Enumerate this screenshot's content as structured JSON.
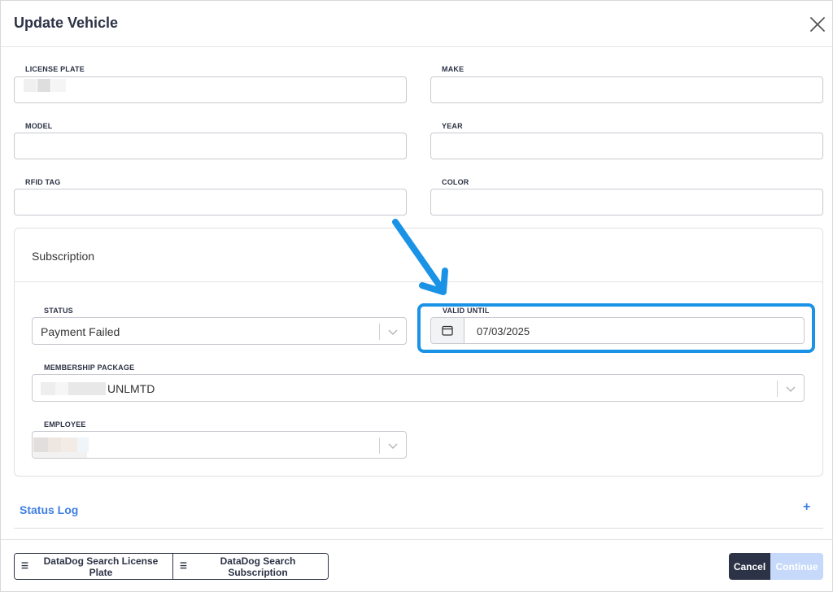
{
  "modal": {
    "title": "Update Vehicle",
    "close_icon": "close-icon"
  },
  "fields": {
    "license_plate": {
      "label": "LICENSE PLATE",
      "value": ""
    },
    "make": {
      "label": "MAKE",
      "value": ""
    },
    "model": {
      "label": "MODEL",
      "value": ""
    },
    "year": {
      "label": "YEAR",
      "value": ""
    },
    "rfid_tag": {
      "label": "RFID TAG",
      "value": ""
    },
    "color": {
      "label": "COLOR",
      "value": ""
    }
  },
  "subscription": {
    "title": "Subscription",
    "status": {
      "label": "STATUS",
      "value": "Payment Failed"
    },
    "valid_until": {
      "label": "VALID UNTIL",
      "value": "07/03/2025",
      "icon": "calendar-icon"
    },
    "membership_package": {
      "label": "MEMBERSHIP PACKAGE",
      "value": "UNLMTD"
    },
    "employee": {
      "label": "EMPLOYEE",
      "value": ""
    }
  },
  "status_log": {
    "title": "Status Log",
    "expand": "+"
  },
  "footer": {
    "datadog_license_plate": "DataDog Search License Plate",
    "datadog_subscription": "DataDog Search Subscription",
    "list_icon": "list-icon",
    "cancel": "Cancel",
    "continue": "Continue"
  },
  "colors": {
    "highlight": "#1a93e6",
    "primary_dark": "#2d3346",
    "link_blue": "#3f7fe4",
    "continue_disabled": "#c6d9fb"
  }
}
